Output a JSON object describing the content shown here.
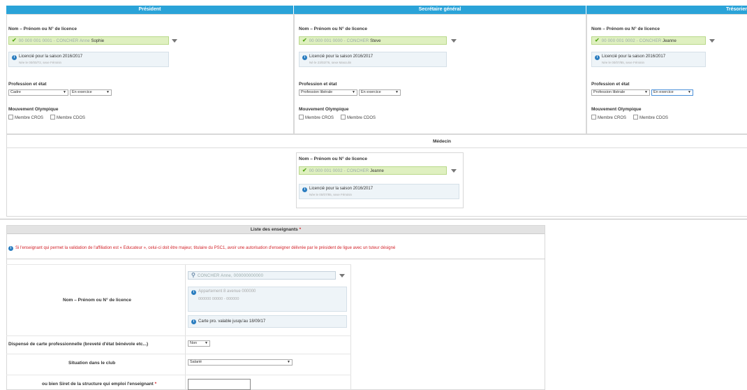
{
  "colors": {
    "header": "#2aa3d8",
    "valid": "#dff0c0",
    "warning": "#d2232a",
    "info_icon": "#2a7dc0"
  },
  "roles": [
    {
      "title": "Président",
      "name_label": "Nom – Prénom ou N° de licence",
      "license_value": "00 000 001 0001 - CONCHER Anne",
      "license_name": "Sophie",
      "info_main": "Licencié pour la saison 2016/2017",
      "info_sub": "Née le 00/00/72, sexe Féminin",
      "profession_label": "Profession et état",
      "profession_value": "Cadre",
      "etat_value": "En exercice",
      "movement_label": "Mouvement Olympique",
      "cb1": "Membre CROS",
      "cb2": "Membre CDOS"
    },
    {
      "title": "Secrétaire général",
      "name_label": "Nom – Prénom ou N° de licence",
      "license_value": "00 000 001 0000 - CONCHER",
      "license_name": "Steve",
      "info_main": "Licencié pour la saison 2016/2017",
      "info_sub": "Né le 23/02/76, sexe Masculin",
      "profession_label": "Profession et état",
      "profession_value": "Profession libérale",
      "etat_value": "En exercice",
      "movement_label": "Mouvement Olympique",
      "cb1": "Membre CROS",
      "cb2": "Membre CDOS"
    },
    {
      "title": "Trésorier",
      "name_label": "Nom – Prénom ou N° de licence",
      "license_value": "00 000 001 0002 - CONCHER",
      "license_name": "Jeanne",
      "info_main": "Licencié pour la saison 2016/2017",
      "info_sub": "Née le 00/07/85, sexe Féminin",
      "profession_label": "Profession et état",
      "profession_value": "Profession libérale",
      "etat_value": "En exercice",
      "movement_label": "Mouvement Olympique",
      "cb1": "Membre CROS",
      "cb2": "Membre CDOS"
    }
  ],
  "medecin": {
    "title": "Médecin",
    "name_label": "Nom – Prénom ou N° de licence",
    "license_value": "00 000 001 0002 - CONCHER",
    "license_name": "Jeanne",
    "info_main": "Licencié pour la saison 2016/2017",
    "info_sub": "Née le 00/07/85, sexe Féminin"
  },
  "enseignants": {
    "title": "Liste des enseignants",
    "required_mark": "*",
    "warning": "Si l'enseignant qui permet la validation de l'affiliation est « Educateur », celui-ci doit être majeur, titulaire du PSC1, avoir une autorisation d'enseigner délivrée par le président de ligue avec un tuteur désigné",
    "name_label": "Nom – Prénom ou N° de licence",
    "search_value": "CONCHER Anne, 000000000000",
    "address_line1": "Appartement 8 avenue 000000",
    "address_line2": "000000 00000 - 000000",
    "carte_text": "Carte pro. valable jusqu'au 18/09/17",
    "dispense_label": "Dispensé de carte professionnelle (breveté d'état bénévole etc...)",
    "dispense_value": "Non",
    "situation_label": "Situation dans le club",
    "situation_value": "Salarié",
    "siret_label": "ou bien Siret de la structure qui emploi l'enseignant",
    "siret_required": "*"
  }
}
